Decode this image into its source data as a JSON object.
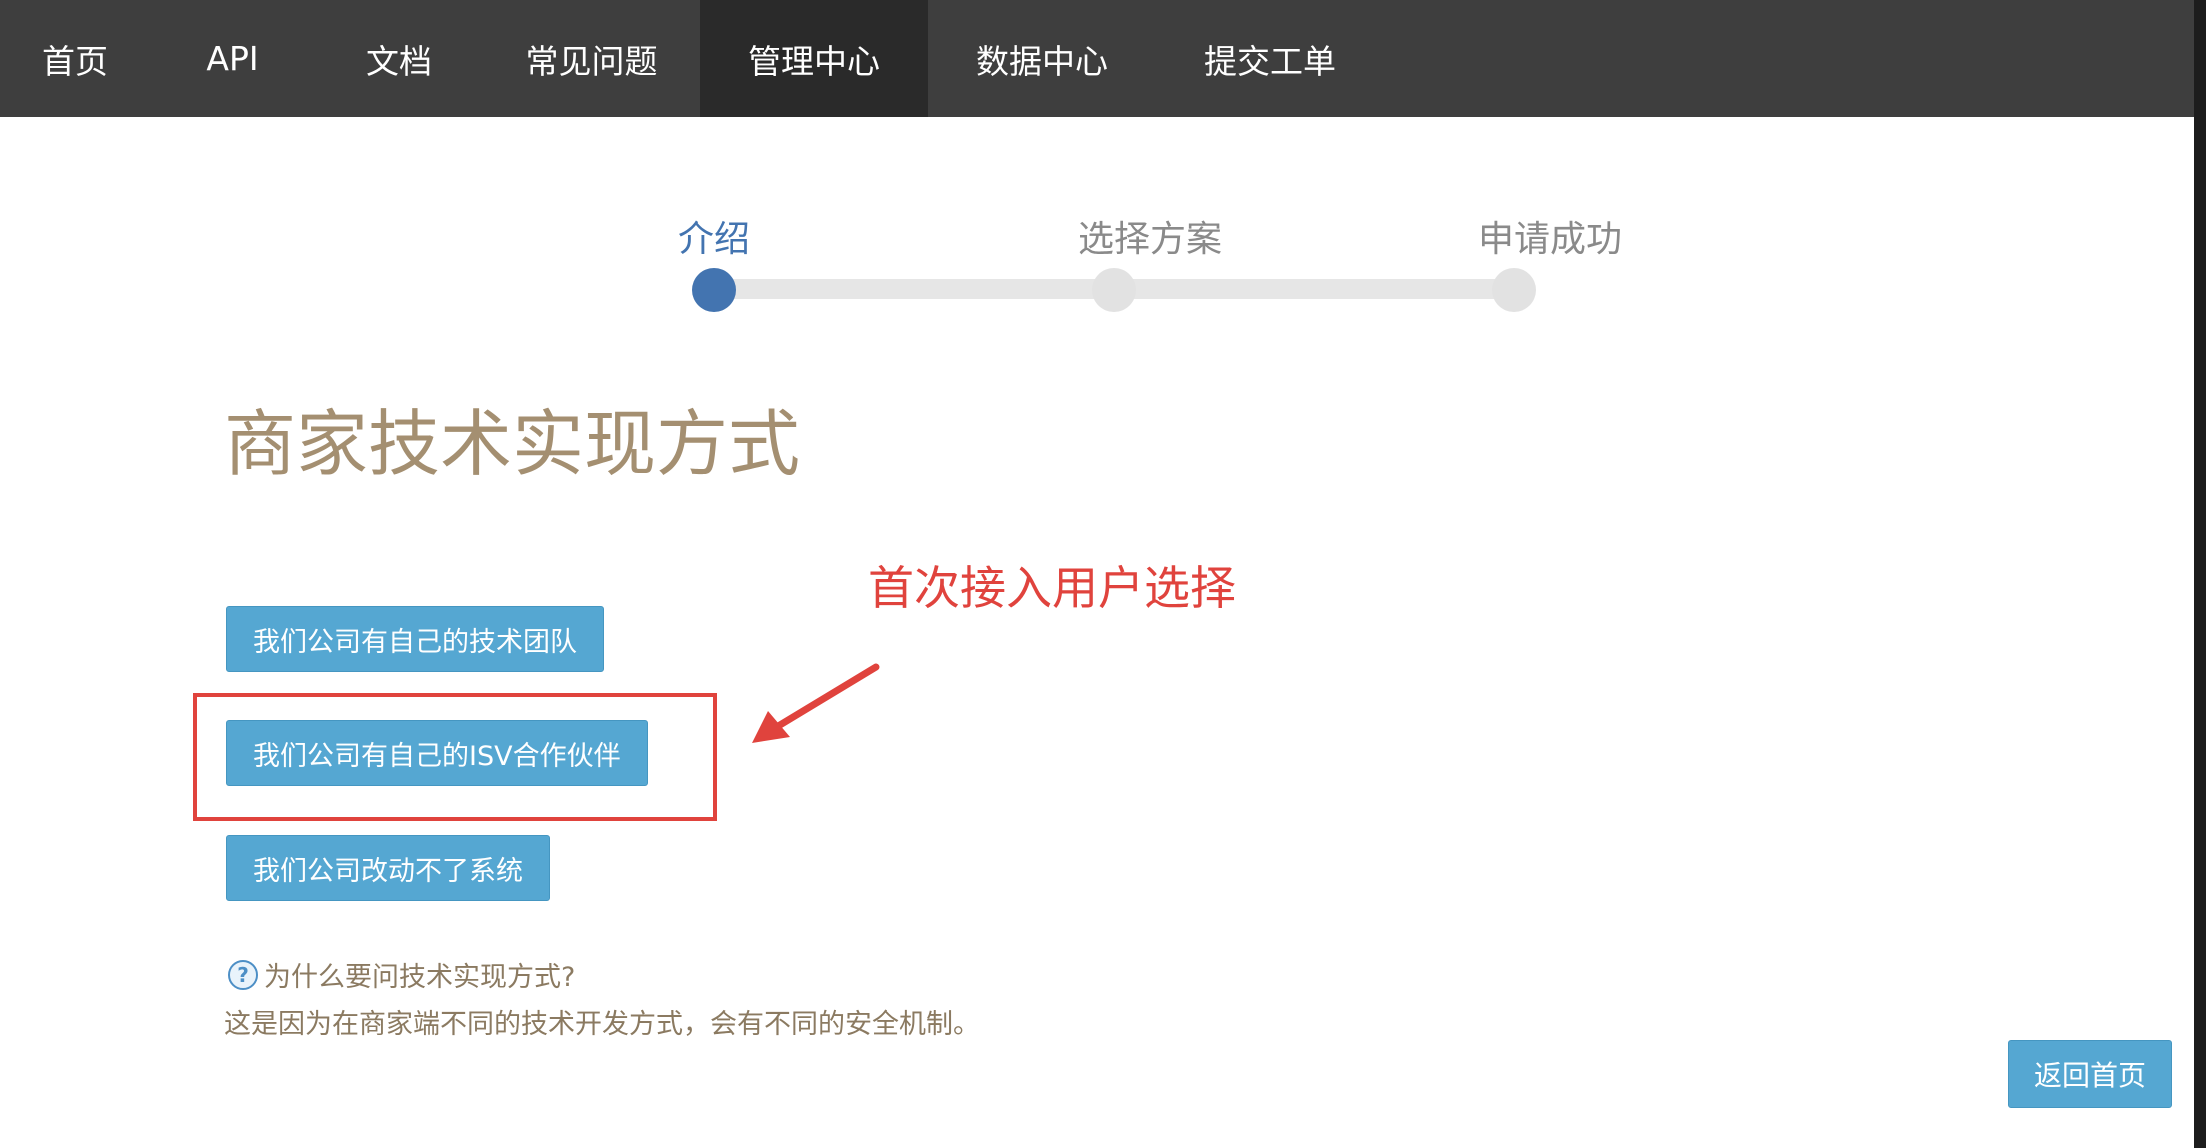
{
  "nav": {
    "items": [
      {
        "label": "首页"
      },
      {
        "label": "API"
      },
      {
        "label": "文档"
      },
      {
        "label": "常见问题"
      },
      {
        "label": "管理中心"
      },
      {
        "label": "数据中心"
      },
      {
        "label": "提交工单"
      }
    ],
    "active_index": 4
  },
  "stepper": {
    "steps": [
      {
        "label": "介绍"
      },
      {
        "label": "选择方案"
      },
      {
        "label": "申请成功"
      }
    ],
    "active_index": 0
  },
  "main": {
    "title": "商家技术实现方式",
    "options": [
      {
        "label": "我们公司有自己的技术团队"
      },
      {
        "label": "我们公司有自己的ISV合作伙伴"
      },
      {
        "label": "我们公司改动不了系统"
      }
    ],
    "help": {
      "question": "为什么要问技术实现方式?",
      "answer": "这是因为在商家端不同的技术开发方式，会有不同的安全机制。"
    },
    "back_button": "返回首页"
  },
  "annotation": {
    "text": "首次接入用户选择",
    "color": "#e0433d"
  },
  "colors": {
    "nav_bg": "#3e3e3e",
    "accent": "#4374b0",
    "button": "#55a7d2",
    "title": "#a48f71"
  }
}
